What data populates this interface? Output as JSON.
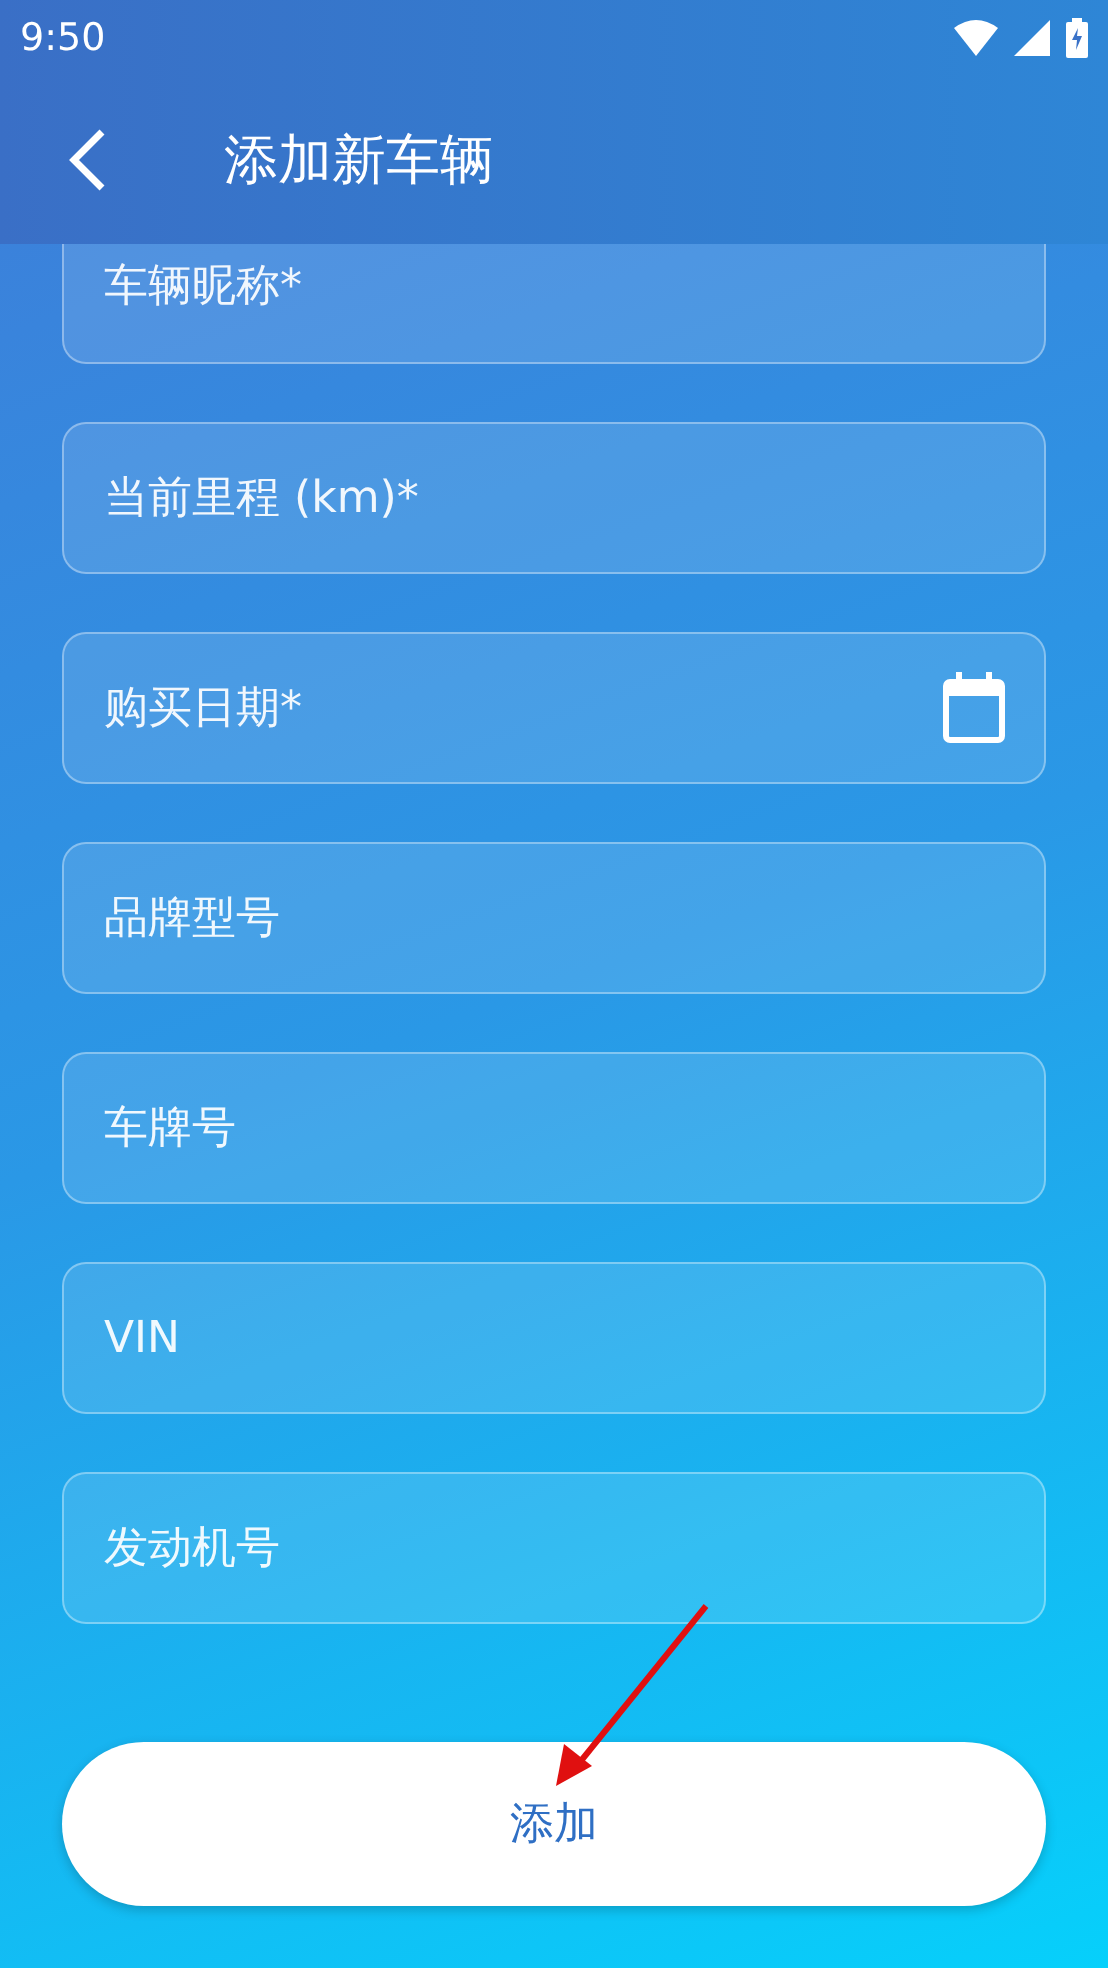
{
  "status_bar": {
    "time": "9:50"
  },
  "app_bar": {
    "title": "添加新车辆"
  },
  "fields": [
    {
      "placeholder": "车辆昵称*",
      "kind": "text"
    },
    {
      "placeholder": "当前里程 (km)*",
      "kind": "text"
    },
    {
      "placeholder": "购买日期*",
      "kind": "date"
    },
    {
      "placeholder": "品牌型号",
      "kind": "text"
    },
    {
      "placeholder": "车牌号",
      "kind": "text"
    },
    {
      "placeholder": "VIN",
      "kind": "text"
    },
    {
      "placeholder": "发动机号",
      "kind": "text"
    }
  ],
  "submit_button": {
    "label": "添加"
  }
}
